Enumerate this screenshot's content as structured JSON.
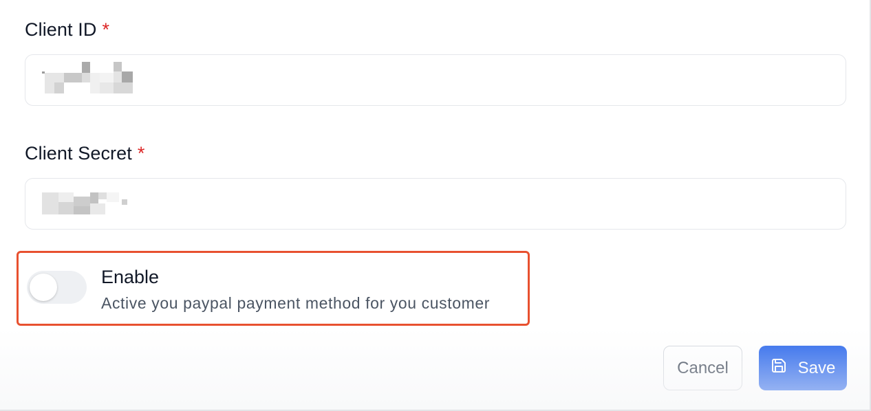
{
  "form": {
    "client_id": {
      "label": "Client ID",
      "required_mark": "*"
    },
    "client_secret": {
      "label": "Client Secret",
      "required_mark": "*"
    },
    "enable_toggle": {
      "title": "Enable",
      "description": "Active you paypal payment method for you customer",
      "checked": false
    }
  },
  "actions": {
    "cancel_label": "Cancel",
    "save_label": "Save",
    "save_icon": "save-icon"
  },
  "colors": {
    "primary": "#2563eb",
    "required": "#dc2626",
    "highlight_border": "#e8512f"
  }
}
